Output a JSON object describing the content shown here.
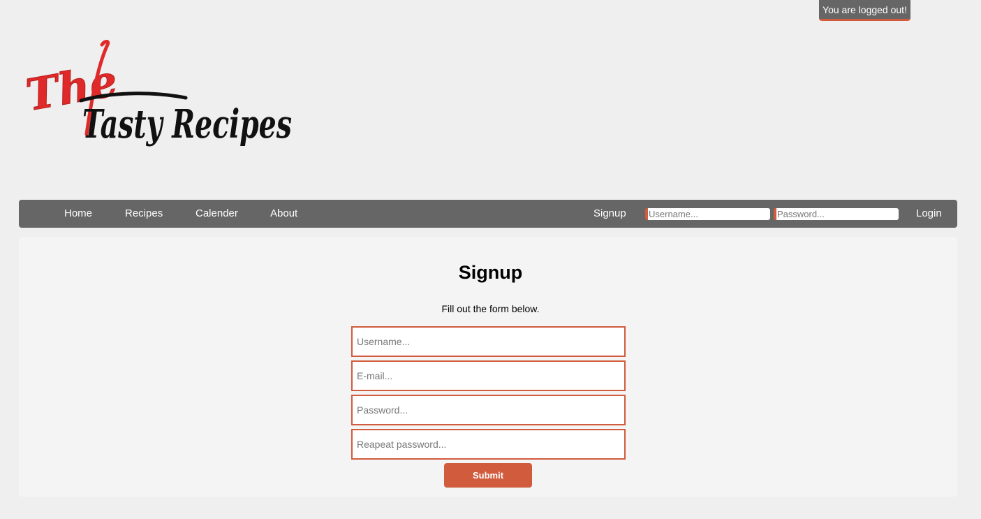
{
  "notice": {
    "text": "You are logged out!"
  },
  "logo": {
    "text_the": "The",
    "text_main": "Tasty Recipes",
    "color_the": "#e02a2a",
    "color_main": "#111111"
  },
  "nav": {
    "left_items": [
      {
        "label": "Home"
      },
      {
        "label": "Recipes"
      },
      {
        "label": "Calender"
      },
      {
        "label": "About"
      }
    ],
    "signup_label": "Signup",
    "username_placeholder": "Username...",
    "password_placeholder": "Password...",
    "login_label": "Login"
  },
  "main": {
    "title": "Signup",
    "subtitle": "Fill out the form below.",
    "fields": {
      "username_placeholder": "Username...",
      "email_placeholder": "E-mail...",
      "password_placeholder": "Password...",
      "repeat_password_placeholder": "Reapeat password..."
    },
    "submit_label": "Submit"
  },
  "colors": {
    "accent": "#d15b3d",
    "nav_background": "#666666",
    "page_background": "#efefef",
    "panel_background": "#f4f4f4"
  }
}
